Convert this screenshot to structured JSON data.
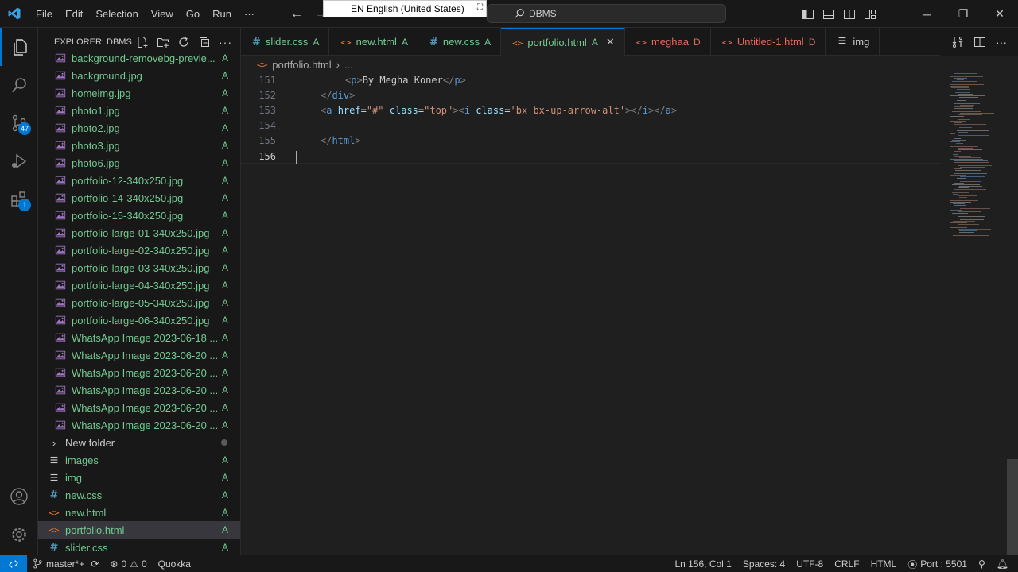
{
  "titlebar": {
    "menu": [
      "File",
      "Edit",
      "Selection",
      "View",
      "Go",
      "Run",
      "···"
    ],
    "search_text": "DBMS",
    "ime_text": "EN English (United States)"
  },
  "activity": {
    "scm_badge": "47",
    "extensions_badge": "1"
  },
  "explorer": {
    "title": "EXPLORER: DBMS",
    "items": [
      {
        "name": "background-removebg-previe...",
        "status": "A",
        "type": "image",
        "level": "sub"
      },
      {
        "name": "background.jpg",
        "status": "A",
        "type": "image",
        "level": "sub"
      },
      {
        "name": "homeimg.jpg",
        "status": "A",
        "type": "image",
        "level": "sub"
      },
      {
        "name": "photo1.jpg",
        "status": "A",
        "type": "image",
        "level": "sub"
      },
      {
        "name": "photo2.jpg",
        "status": "A",
        "type": "image",
        "level": "sub"
      },
      {
        "name": "photo3.jpg",
        "status": "A",
        "type": "image",
        "level": "sub"
      },
      {
        "name": "photo6.jpg",
        "status": "A",
        "type": "image",
        "level": "sub"
      },
      {
        "name": "portfolio-12-340x250.jpg",
        "status": "A",
        "type": "image",
        "level": "sub"
      },
      {
        "name": "portfolio-14-340x250.jpg",
        "status": "A",
        "type": "image",
        "level": "sub"
      },
      {
        "name": "portfolio-15-340x250.jpg",
        "status": "A",
        "type": "image",
        "level": "sub"
      },
      {
        "name": "portfolio-large-01-340x250.jpg",
        "status": "A",
        "type": "image",
        "level": "sub"
      },
      {
        "name": "portfolio-large-02-340x250.jpg",
        "status": "A",
        "type": "image",
        "level": "sub"
      },
      {
        "name": "portfolio-large-03-340x250.jpg",
        "status": "A",
        "type": "image",
        "level": "sub"
      },
      {
        "name": "portfolio-large-04-340x250.jpg",
        "status": "A",
        "type": "image",
        "level": "sub"
      },
      {
        "name": "portfolio-large-05-340x250.jpg",
        "status": "A",
        "type": "image",
        "level": "sub"
      },
      {
        "name": "portfolio-large-06-340x250.jpg",
        "status": "A",
        "type": "image",
        "level": "sub"
      },
      {
        "name": "WhatsApp Image 2023-06-18 ...",
        "status": "A",
        "type": "image",
        "level": "sub"
      },
      {
        "name": "WhatsApp Image 2023-06-20 ...",
        "status": "A",
        "type": "image",
        "level": "sub"
      },
      {
        "name": "WhatsApp Image 2023-06-20 ...",
        "status": "A",
        "type": "image",
        "level": "sub"
      },
      {
        "name": "WhatsApp Image 2023-06-20 ...",
        "status": "A",
        "type": "image",
        "level": "sub"
      },
      {
        "name": "WhatsApp Image 2023-06-20 ...",
        "status": "A",
        "type": "image",
        "level": "sub"
      },
      {
        "name": "WhatsApp Image 2023-06-20 ...",
        "status": "A",
        "type": "image",
        "level": "sub"
      },
      {
        "name": "New folder",
        "status": "",
        "type": "folder",
        "level": "top"
      },
      {
        "name": "images",
        "status": "A",
        "type": "lines",
        "level": "top"
      },
      {
        "name": "img",
        "status": "A",
        "type": "lines",
        "level": "top"
      },
      {
        "name": "new.css",
        "status": "A",
        "type": "css",
        "level": "top"
      },
      {
        "name": "new.html",
        "status": "A",
        "type": "html",
        "level": "top"
      },
      {
        "name": "portfolio.html",
        "status": "A",
        "type": "html",
        "level": "top",
        "selected": true
      },
      {
        "name": "slider.css",
        "status": "A",
        "type": "css",
        "level": "top"
      }
    ]
  },
  "tabs": [
    {
      "label": "slider.css",
      "status": "A",
      "type": "css"
    },
    {
      "label": "new.html",
      "status": "A",
      "type": "html"
    },
    {
      "label": "new.css",
      "status": "A",
      "type": "css"
    },
    {
      "label": "portfolio.html",
      "status": "A",
      "type": "html",
      "active": true
    },
    {
      "label": "meghaa",
      "status": "D",
      "type": "html-red"
    },
    {
      "label": "Untitled-1.html",
      "status": "D",
      "type": "html-red"
    },
    {
      "label": "img",
      "status": "",
      "type": "lines"
    }
  ],
  "breadcrumb": {
    "file": "portfolio.html",
    "more": "..."
  },
  "editor": {
    "lines": [
      {
        "num": "151",
        "indent": "    ",
        "tokens": [
          [
            "tg",
            "<"
          ],
          [
            "tn",
            "p"
          ],
          [
            "tg",
            ">"
          ],
          [
            "tx",
            "By Megha Koner"
          ],
          [
            "tg",
            "</"
          ],
          [
            "tn",
            "p"
          ],
          [
            "tg",
            ">"
          ]
        ]
      },
      {
        "num": "152",
        "indent": "",
        "tokens": [
          [
            "tg",
            "</"
          ],
          [
            "tn",
            "div"
          ],
          [
            "tg",
            ">"
          ]
        ]
      },
      {
        "num": "153",
        "indent": "",
        "tokens": [
          [
            "tg",
            "<"
          ],
          [
            "tn",
            "a"
          ],
          [
            "tx",
            " "
          ],
          [
            "at",
            "href"
          ],
          [
            "tx",
            "="
          ],
          [
            "sv",
            "\"#\""
          ],
          [
            "tx",
            " "
          ],
          [
            "at",
            "class"
          ],
          [
            "tx",
            "="
          ],
          [
            "sv",
            "\"top\""
          ],
          [
            "tg",
            ">"
          ],
          [
            "tg",
            "<"
          ],
          [
            "tn",
            "i"
          ],
          [
            "tx",
            " "
          ],
          [
            "at",
            "class"
          ],
          [
            "tx",
            "="
          ],
          [
            "sv",
            "'bx bx-up-arrow-alt'"
          ],
          [
            "tg",
            "></"
          ],
          [
            "tn",
            "i"
          ],
          [
            "tg",
            "></"
          ],
          [
            "tn",
            "a"
          ],
          [
            "tg",
            ">"
          ]
        ]
      },
      {
        "num": "154",
        "indent": "",
        "tokens": []
      },
      {
        "num": "155",
        "indent": "",
        "tokens": [
          [
            "tg",
            "</"
          ],
          [
            "tn",
            "html"
          ],
          [
            "tg",
            ">"
          ]
        ]
      },
      {
        "num": "156",
        "indent": "",
        "tokens": [],
        "current": true
      }
    ]
  },
  "status": {
    "branch": "master*+",
    "errors": "0",
    "warnings": "0",
    "quokka": "Quokka",
    "position": "Ln 156, Col 1",
    "spaces": "Spaces: 4",
    "encoding": "UTF-8",
    "eol": "CRLF",
    "language": "HTML",
    "port": "Port : 5501"
  },
  "colors": {
    "accent": "#0078d4",
    "added": "#73c991",
    "deleted": "#e06c5a",
    "html_icon": "#e37933",
    "css_icon": "#519aba",
    "image_icon": "#a074c4"
  }
}
